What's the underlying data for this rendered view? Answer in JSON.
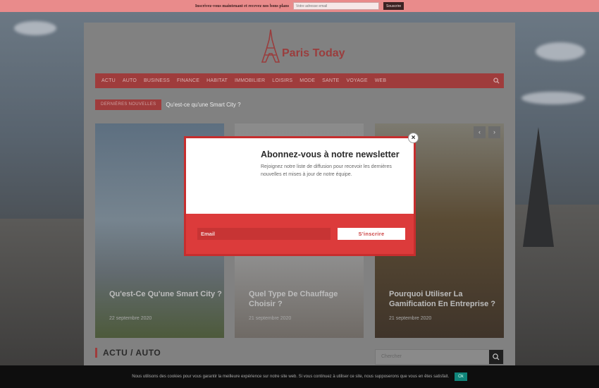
{
  "topbar": {
    "text": "Inscrivez-vous maintenant et recevez nos bons plans",
    "email_placeholder": "Votre adresse email",
    "button_label": "Souscrire"
  },
  "brand": {
    "name": "Paris Today",
    "color": "#c62e2e"
  },
  "nav": {
    "items": [
      {
        "label": "ACTU"
      },
      {
        "label": "AUTO"
      },
      {
        "label": "BUSINESS"
      },
      {
        "label": "FINANCE"
      },
      {
        "label": "HABITAT"
      },
      {
        "label": "IMMOBILIER"
      },
      {
        "label": "LOISIRS"
      },
      {
        "label": "MODE"
      },
      {
        "label": "SANTE"
      },
      {
        "label": "VOYAGE"
      },
      {
        "label": "WEB"
      }
    ]
  },
  "ticker": {
    "label": "DERNIÈRES NOUVELLES",
    "text": "Qu'est-ce qu'une Smart City ?"
  },
  "cards": [
    {
      "title": "Qu'est-Ce Qu'une Smart City ?",
      "date": "22 septembre 2020"
    },
    {
      "title": "Quel Type De Chauffage Choisir ?",
      "date": "21 septembre 2020"
    },
    {
      "title": "Pourquoi Utiliser La Gamification En Entreprise ?",
      "date": "21 septembre 2020"
    }
  ],
  "slider": {
    "prev": "‹",
    "next": "›"
  },
  "section": {
    "title": "ACTU / AUTO"
  },
  "sidebar_search": {
    "placeholder": "Chercher"
  },
  "popup": {
    "heading": "Abonnez-vous à notre newsletter",
    "description": "Rejoignez notre liste de diffusion pour recevoir les dernières nouvelles et mises à jour de notre équipe.",
    "email_placeholder": "Email",
    "submit_label": "S'inscrire",
    "close": "×"
  },
  "cookie": {
    "message": "Nous utilisons des cookies pour vous garantir la meilleure expérience sur notre site web. Si vous continuez à utiliser ce site, nous supposerons que vous en êtes satisfait.",
    "ok_label": "Ok"
  }
}
